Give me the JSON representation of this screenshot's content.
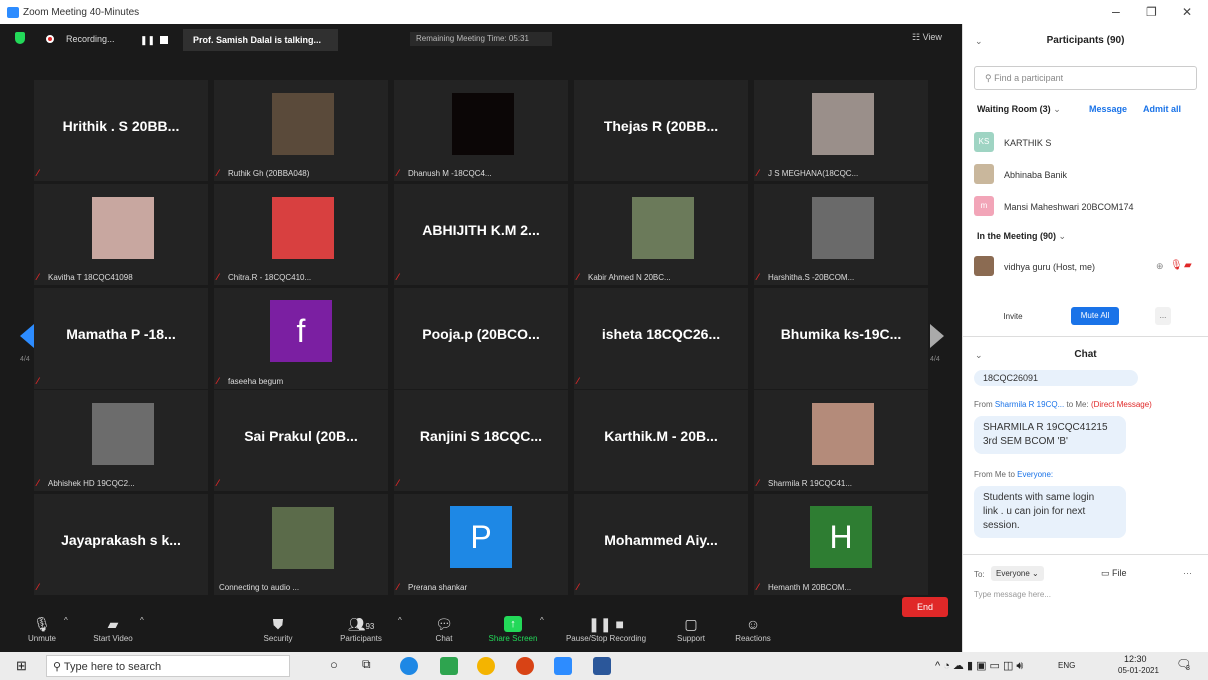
{
  "window": {
    "title": "Zoom Meeting 40-Minutes",
    "minimize": "–",
    "maximize": "❐",
    "close": "✕"
  },
  "topbar": {
    "recording_label": "Recording...",
    "pause_glyph": "❚❚",
    "talking": "Prof. Samish Dalal is talking...",
    "remaining": "Remaining Meeting Time: 05:31",
    "view_label": "View"
  },
  "grid": {
    "page_left": "4/4",
    "page_right": "4/4",
    "tiles": [
      {
        "name": "Hrithik . S 20BB...",
        "caption": "",
        "muted": true
      },
      {
        "name": "",
        "caption": "Ruthik Gh (20BBA048)",
        "muted": true,
        "photo": "person-photo-1"
      },
      {
        "name": "",
        "caption": "Dhanush M -18CQC4...",
        "muted": true,
        "photo": "dark-video"
      },
      {
        "name": "Thejas R (20BB...",
        "caption": "",
        "muted": false
      },
      {
        "name": "",
        "caption": "J S MEGHANA(18CQC...",
        "muted": true,
        "photo": "person-photo-2"
      },
      {
        "name": "",
        "caption": "Kavitha T 18CQC41098",
        "muted": true,
        "photo": "person-photo-3"
      },
      {
        "name": "",
        "caption": "Chitra.R - 18CQC410...",
        "muted": true,
        "photo": "person-photo-4"
      },
      {
        "name": "ABHIJITH K.M 2...",
        "caption": "",
        "muted": true
      },
      {
        "name": "",
        "caption": "Kabir Ahmed N 20BC...",
        "muted": true,
        "photo": "person-photo-5"
      },
      {
        "name": "",
        "caption": "Harshitha.S -20BCOM...",
        "muted": true,
        "photo": "person-photo-6"
      },
      {
        "name": "Mamatha P -18...",
        "caption": "",
        "muted": true
      },
      {
        "name": "",
        "caption": "faseeha begum",
        "muted": true,
        "avatar": "f",
        "avatar_color": "#7b1fa2"
      },
      {
        "name": "Pooja.p (20BCO...",
        "caption": "",
        "muted": false
      },
      {
        "name": "isheta 18CQC26...",
        "caption": "",
        "muted": true
      },
      {
        "name": "Bhumika ks-19C...",
        "caption": "",
        "muted": false
      },
      {
        "name": "",
        "caption": "Abhishek HD 19CQC2...",
        "muted": true,
        "photo": "person-photo-7"
      },
      {
        "name": "Sai Prakul (20B...",
        "caption": "",
        "muted": true
      },
      {
        "name": "Ranjini S 18CQC...",
        "caption": "",
        "muted": true
      },
      {
        "name": "Karthik.M - 20B...",
        "caption": "",
        "muted": false
      },
      {
        "name": "",
        "caption": "Sharmila R 19CQC41...",
        "muted": true,
        "photo": "person-photo-8"
      },
      {
        "name": "Jayaprakash s k...",
        "caption": "",
        "muted": true
      },
      {
        "name": "",
        "caption": "Connecting to audio ...",
        "muted": false,
        "photo": "person-photo-9"
      },
      {
        "name": "",
        "caption": "Prerana shankar",
        "muted": true,
        "avatar": "P",
        "avatar_color": "#1e88e5"
      },
      {
        "name": "Mohammed Aiy...",
        "caption": "",
        "muted": true
      },
      {
        "name": "",
        "caption": "Hemanth M 20BCOM...",
        "muted": true,
        "avatar": "H",
        "avatar_color": "#2e7d32"
      }
    ]
  },
  "toolbar": {
    "unmute": "Unmute",
    "start_video": "Start Video",
    "security": "Security",
    "participants": "Participants",
    "participants_count": "93",
    "chat": "Chat",
    "share_screen": "Share Screen",
    "pause_recording": "Pause/Stop Recording",
    "support": "Support",
    "reactions": "Reactions",
    "end": "End"
  },
  "panel": {
    "participants_title": "Participants (90)",
    "search_placeholder": "Find a participant",
    "waiting_room": "Waiting Room (3)",
    "message_link": "Message",
    "admit_all": "Admit all",
    "waiting": [
      {
        "name": "KARTHIK S",
        "initials": "KS",
        "color": "#9fd4c3"
      },
      {
        "name": "Abhinaba Banik",
        "initials": "",
        "color": "#c9b79c"
      },
      {
        "name": "Mansi Maheshwari 20BCOM174",
        "initials": "m",
        "color": "#f2a5b8"
      }
    ],
    "in_meeting": "In the Meeting (90)",
    "host": "vidhya guru (Host, me)",
    "invite": "Invite",
    "mute_all": "Mute All",
    "more": "...",
    "chat_title": "Chat",
    "chat_prev": "18CQC26091",
    "msg1_meta_from": "From ",
    "msg1_sender": "Sharmila R 19CQ...",
    "msg1_to": " to Me: ",
    "msg1_direct": "(Direct Message)",
    "msg1_line1": "SHARMILA R 19CQC41215",
    "msg1_line2": "3rd SEM BCOM 'B'",
    "msg2_meta": "From Me to ",
    "msg2_to": "Everyone:",
    "msg2_line1": "Students with same login",
    "msg2_line2": "link . u can join for next",
    "msg2_line3": "session.",
    "to_label": "To:",
    "to_value": "Everyone",
    "file": "File",
    "input_placeholder": "Type message here..."
  },
  "taskbar": {
    "search": "Type here to search",
    "lang": "ENG",
    "time": "12:30",
    "date": "05-01-2021",
    "notif": "3"
  }
}
